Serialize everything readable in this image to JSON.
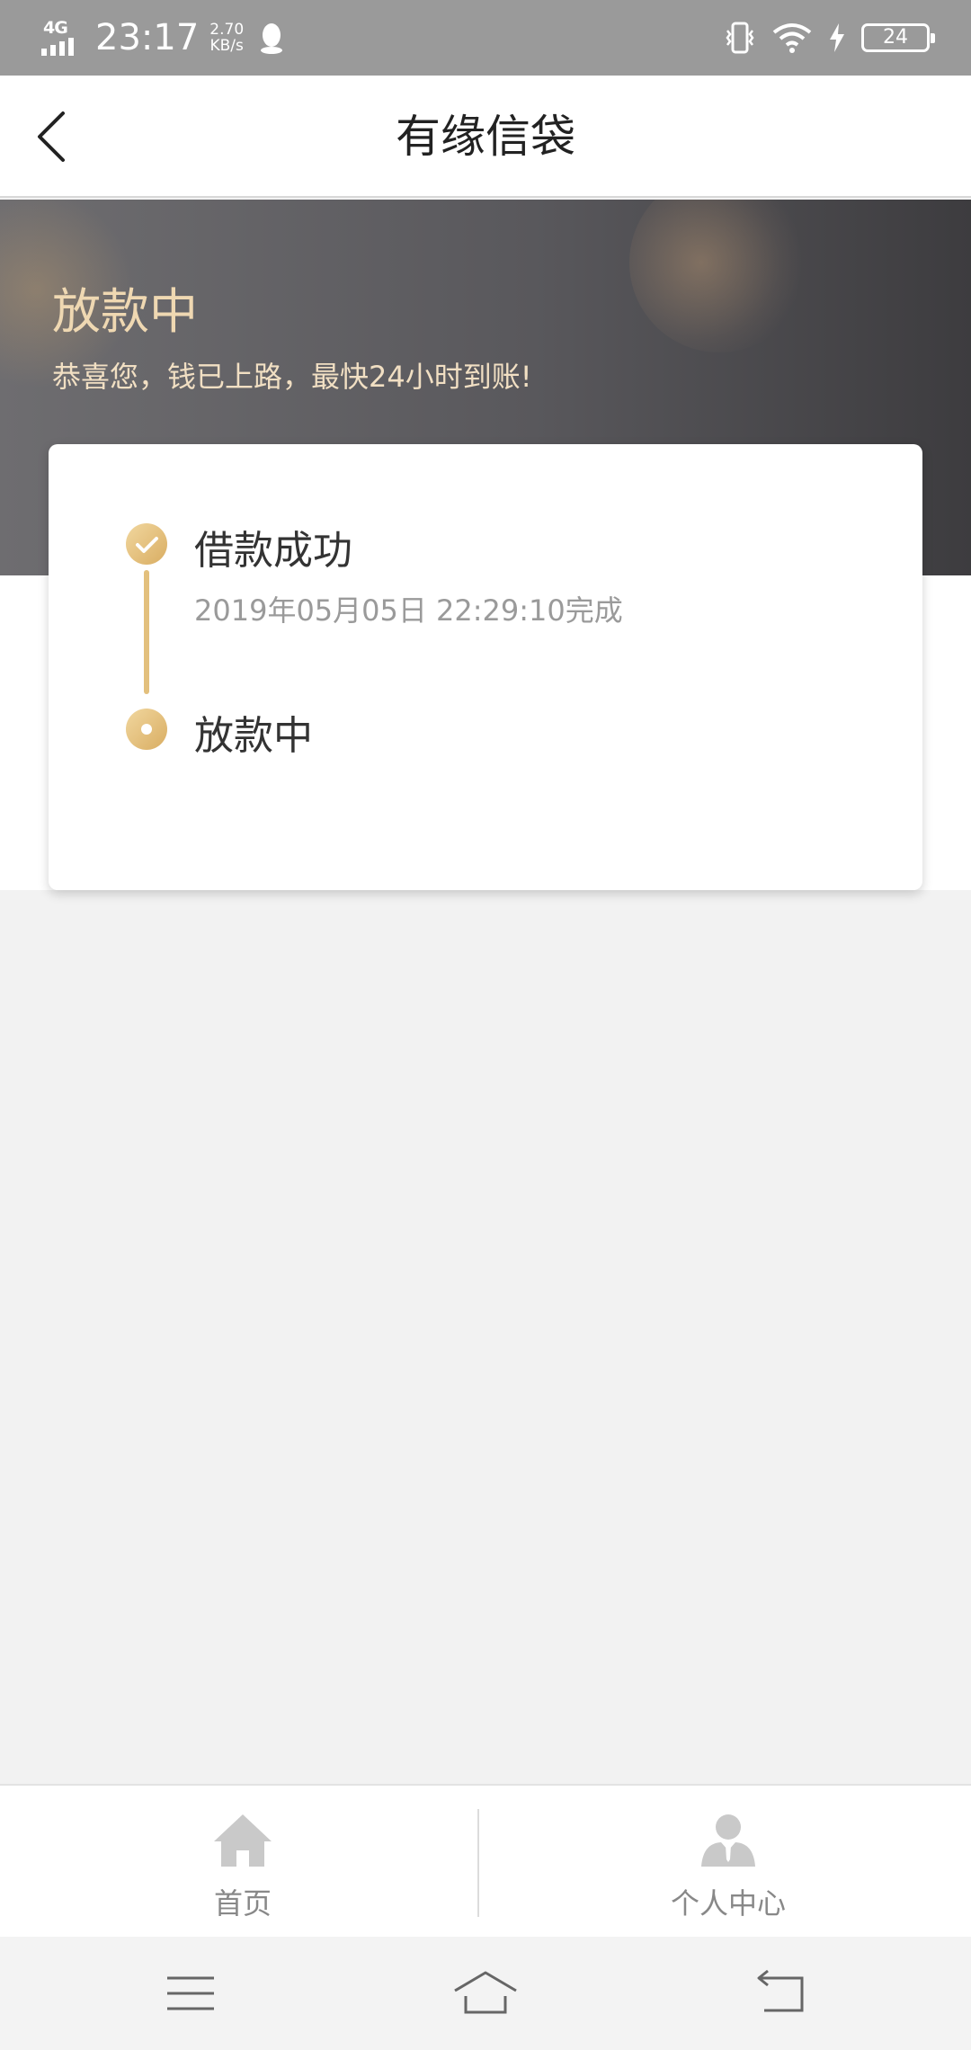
{
  "status_bar": {
    "network": "4G",
    "time": "23:17",
    "speed_value": "2.70",
    "speed_unit": "KB/s",
    "battery": "24"
  },
  "navbar": {
    "title": "有缘信袋"
  },
  "hero": {
    "title": "放款中",
    "subtitle": "恭喜您，钱已上路，最快24小时到账!"
  },
  "progress": {
    "steps": [
      {
        "label": "借款成功",
        "time": "2019年05月05日 22:29:10完成",
        "status": "completed"
      },
      {
        "label": "放款中",
        "status": "current"
      }
    ],
    "accent_color": "#e3c07d"
  },
  "tabbar": {
    "items": [
      {
        "label": "首页",
        "icon": "home-icon"
      },
      {
        "label": "个人中心",
        "icon": "user-icon"
      }
    ]
  },
  "system_nav": {
    "items": [
      "menu-icon",
      "home-outline-icon",
      "back-icon"
    ]
  }
}
